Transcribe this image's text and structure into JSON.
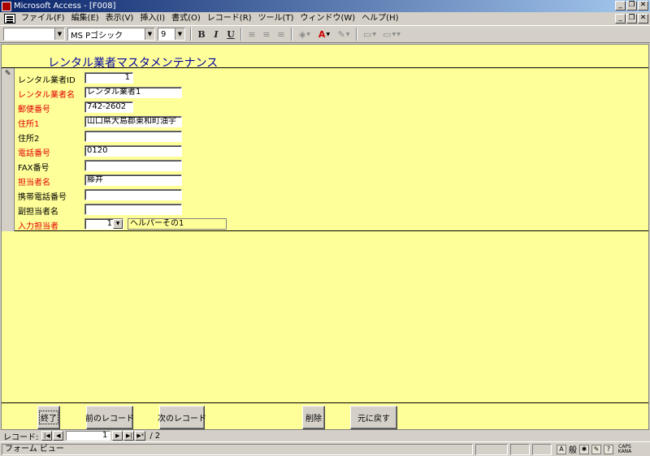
{
  "window": {
    "title": "Microsoft Access - [F008]",
    "controls": [
      "_",
      "❐",
      "✕"
    ]
  },
  "menu": {
    "items": [
      "ファイル(F)",
      "編集(E)",
      "表示(V)",
      "挿入(I)",
      "書式(O)",
      "レコード(R)",
      "ツール(T)",
      "ウィンドウ(W)",
      "ヘルプ(H)"
    ]
  },
  "toolbar": {
    "object_combo": "",
    "font_name": "MS Pゴシック",
    "font_size": "9",
    "bold": "B",
    "italic": "I",
    "underline": "U"
  },
  "form": {
    "title": "レンタル業者マスタメンテナンス",
    "fields": [
      {
        "label": "レンタル業者ID",
        "value": "1",
        "required": false
      },
      {
        "label": "レンタル業者名",
        "value": "レンタル業者1",
        "required": true
      },
      {
        "label": "郵便番号",
        "value": "742-2602",
        "required": true
      },
      {
        "label": "住所1",
        "value": "山口県大島郡東和町油宇",
        "required": true
      },
      {
        "label": "住所2",
        "value": "",
        "required": false
      },
      {
        "label": "電話番号",
        "value": "0120",
        "required": true
      },
      {
        "label": "FAX番号",
        "value": "",
        "required": false
      },
      {
        "label": "担当者名",
        "value": "藤井",
        "required": true
      },
      {
        "label": "携帯電話番号",
        "value": "",
        "required": false
      },
      {
        "label": "副担当者名",
        "value": "",
        "required": false
      },
      {
        "label": "入力担当者",
        "value": "1",
        "required": true
      }
    ],
    "input_person_name": "ヘルパーその1"
  },
  "buttons": {
    "close": "終了",
    "prev": "前のレコード",
    "next": "次のレコード",
    "delete": "削除",
    "undo": "元に戻す"
  },
  "navigation": {
    "label": "レコード:",
    "current": "1",
    "separator": "/",
    "total": "2"
  },
  "status": {
    "text": "フォーム ビュー",
    "ime_mode": "般",
    "caps": "CAPS",
    "kana": "KANA"
  }
}
